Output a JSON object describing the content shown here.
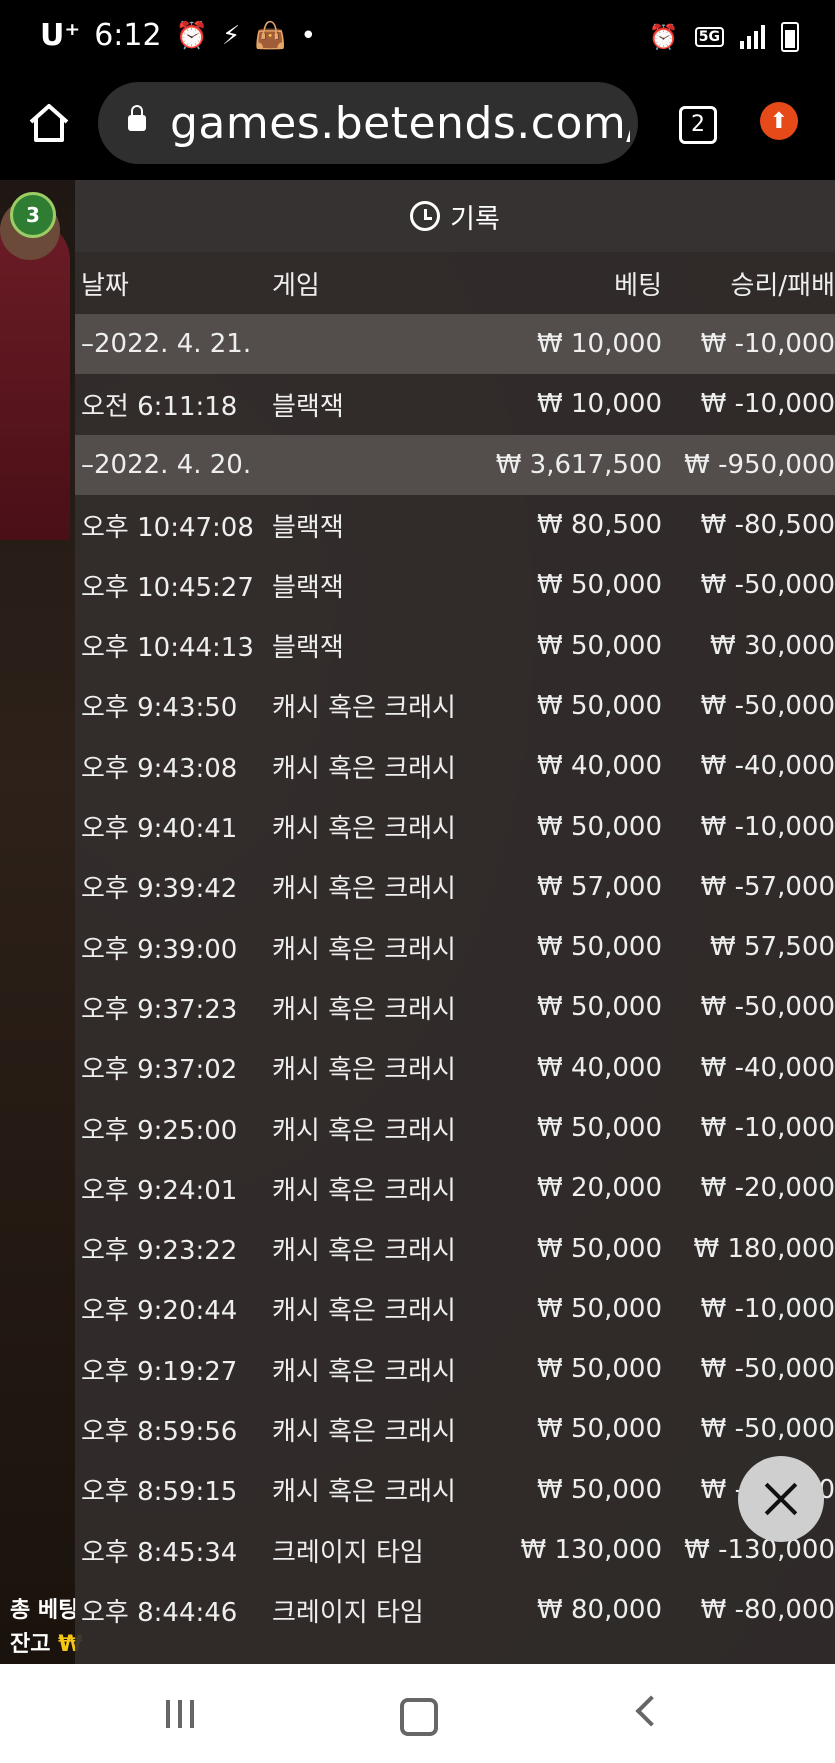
{
  "status_bar": {
    "carrier": "U⁺",
    "time": "6:12",
    "network": "5G"
  },
  "browser": {
    "url": "games.betends.com/",
    "tab_count": "2"
  },
  "game": {
    "badge": "3",
    "total_bet_label": "총 베팅",
    "balance_label": "잔고",
    "currency": "₩"
  },
  "panel": {
    "title": "기록",
    "headers": {
      "date": "날짜",
      "game": "게임",
      "bet": "베팅",
      "win_loss": "승리/패배"
    }
  },
  "rows": [
    {
      "type": "date",
      "date": "–2022. 4. 21.",
      "game": "",
      "bet": "₩ 10,000",
      "result": "₩ -10,000"
    },
    {
      "type": "item",
      "date": "오전 6:11:18",
      "game": "블랙잭",
      "bet": "₩ 10,000",
      "result": "₩ -10,000"
    },
    {
      "type": "date",
      "date": "–2022. 4. 20.",
      "game": "",
      "bet": "₩ 3,617,500",
      "result": "₩ -950,000"
    },
    {
      "type": "item",
      "date": "오후 10:47:08",
      "game": "블랙잭",
      "bet": "₩ 80,500",
      "result": "₩ -80,500"
    },
    {
      "type": "item",
      "date": "오후 10:45:27",
      "game": "블랙잭",
      "bet": "₩ 50,000",
      "result": "₩ -50,000"
    },
    {
      "type": "item",
      "date": "오후 10:44:13",
      "game": "블랙잭",
      "bet": "₩ 50,000",
      "result": "₩ 30,000"
    },
    {
      "type": "item",
      "date": "오후 9:43:50",
      "game": "캐시 혹은 크래시",
      "bet": "₩ 50,000",
      "result": "₩ -50,000"
    },
    {
      "type": "item",
      "date": "오후 9:43:08",
      "game": "캐시 혹은 크래시",
      "bet": "₩ 40,000",
      "result": "₩ -40,000"
    },
    {
      "type": "item",
      "date": "오후 9:40:41",
      "game": "캐시 혹은 크래시",
      "bet": "₩ 50,000",
      "result": "₩ -10,000"
    },
    {
      "type": "item",
      "date": "오후 9:39:42",
      "game": "캐시 혹은 크래시",
      "bet": "₩ 57,000",
      "result": "₩ -57,000"
    },
    {
      "type": "item",
      "date": "오후 9:39:00",
      "game": "캐시 혹은 크래시",
      "bet": "₩ 50,000",
      "result": "₩ 57,500"
    },
    {
      "type": "item",
      "date": "오후 9:37:23",
      "game": "캐시 혹은 크래시",
      "bet": "₩ 50,000",
      "result": "₩ -50,000"
    },
    {
      "type": "item",
      "date": "오후 9:37:02",
      "game": "캐시 혹은 크래시",
      "bet": "₩ 40,000",
      "result": "₩ -40,000"
    },
    {
      "type": "item",
      "date": "오후 9:25:00",
      "game": "캐시 혹은 크래시",
      "bet": "₩ 50,000",
      "result": "₩ -10,000"
    },
    {
      "type": "item",
      "date": "오후 9:24:01",
      "game": "캐시 혹은 크래시",
      "bet": "₩ 20,000",
      "result": "₩ -20,000"
    },
    {
      "type": "item",
      "date": "오후 9:23:22",
      "game": "캐시 혹은 크래시",
      "bet": "₩ 50,000",
      "result": "₩ 180,000"
    },
    {
      "type": "item",
      "date": "오후 9:20:44",
      "game": "캐시 혹은 크래시",
      "bet": "₩ 50,000",
      "result": "₩ -10,000"
    },
    {
      "type": "item",
      "date": "오후 9:19:27",
      "game": "캐시 혹은 크래시",
      "bet": "₩ 50,000",
      "result": "₩ -50,000"
    },
    {
      "type": "item",
      "date": "오후 8:59:56",
      "game": "캐시 혹은 크래시",
      "bet": "₩ 50,000",
      "result": "₩ -50,000"
    },
    {
      "type": "item",
      "date": "오후 8:59:15",
      "game": "캐시 혹은 크래시",
      "bet": "₩ 50,000",
      "result": "₩ -50,000"
    },
    {
      "type": "item",
      "date": "오후 8:45:34",
      "game": "크레이지 타임",
      "bet": "₩ 130,000",
      "result": "₩ -130,000"
    },
    {
      "type": "item",
      "date": "오후 8:44:46",
      "game": "크레이지 타임",
      "bet": "₩ 80,000",
      "result": "₩ -80,000"
    }
  ]
}
